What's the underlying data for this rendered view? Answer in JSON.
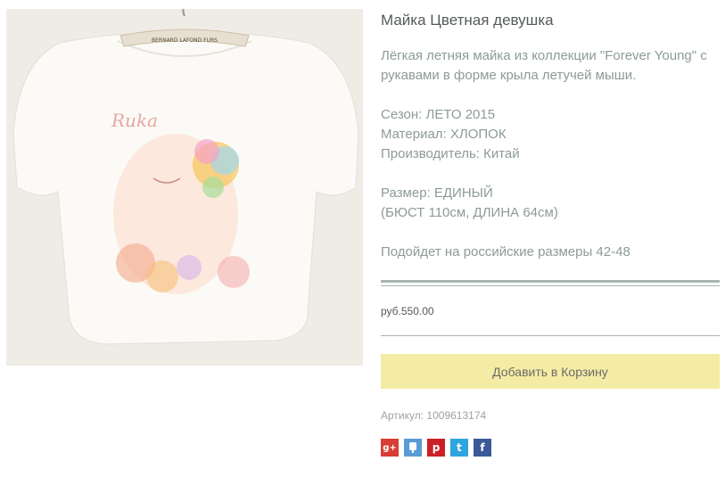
{
  "product": {
    "title": "Майка Цветная девушка",
    "image_alt": "product-photo",
    "description": [
      "Лёгкая летняя майка из коллекции \"Forever Young\" с рукавами в форме крыла летучей мыши."
    ],
    "specs": [
      "Сезон: ЛЕТО 2015",
      "Материал: ХЛОПОК",
      "Производитель: Китай"
    ],
    "size": [
      "Размер: ЕДИНЫЙ",
      "(БЮСТ 110см, ДЛИНА 64см)"
    ],
    "fit_note": "Подойдет на российские размеры 42-48",
    "price": "руб.550.00",
    "add_to_cart_label": "Добавить в Корзину",
    "sku_label": "Артикул:",
    "sku_value": "1009613174",
    "hanger_tag_text": "BERNARD LAFOND FURS",
    "print_text": "Ruka"
  },
  "share": {
    "google_plus": "g+",
    "digg": "",
    "pinterest": "p",
    "twitter": "t",
    "facebook": "f"
  },
  "colors": {
    "cart_button_bg": "#f4eca4",
    "rule": "#a8b6b1",
    "title_text": "#555a5a",
    "desc_text": "#8d9b98"
  }
}
